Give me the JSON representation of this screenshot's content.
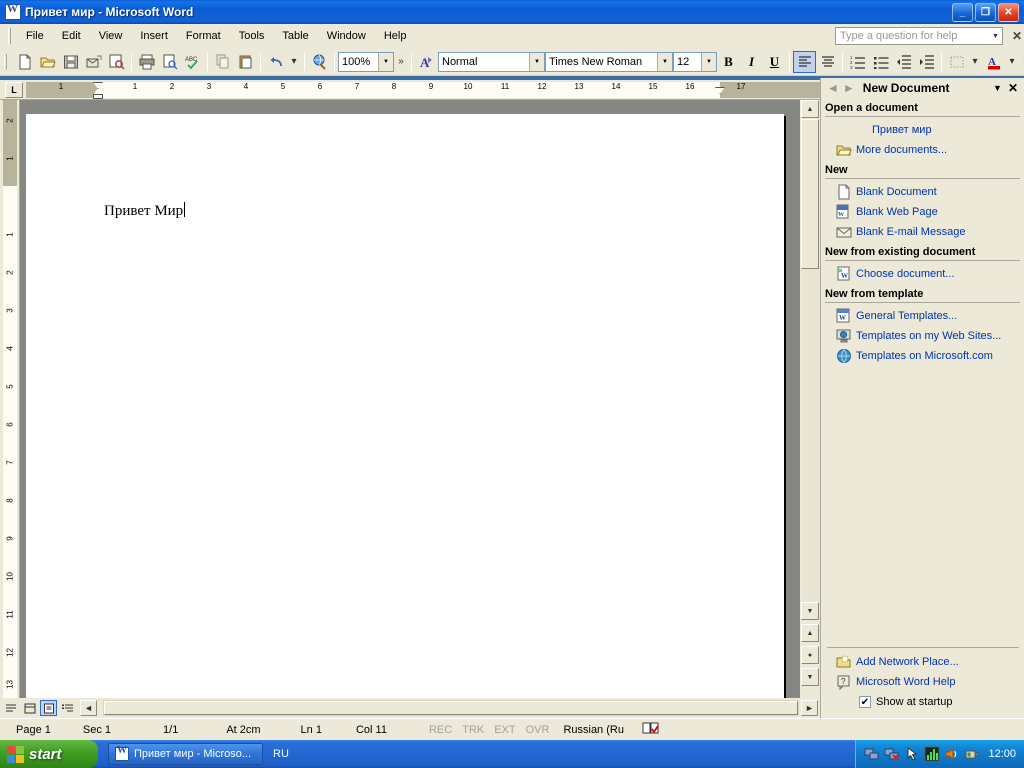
{
  "titlebar": {
    "text": "Привет мир - Microsoft Word",
    "minimize": "_",
    "restore": "❐",
    "close": "✕"
  },
  "menubar": {
    "items": [
      {
        "label": "File"
      },
      {
        "label": "Edit"
      },
      {
        "label": "View"
      },
      {
        "label": "Insert"
      },
      {
        "label": "Format"
      },
      {
        "label": "Tools"
      },
      {
        "label": "Table"
      },
      {
        "label": "Window"
      },
      {
        "label": "Help"
      }
    ],
    "help_placeholder": "Type a question for help"
  },
  "toolbar": {
    "zoom": "100%",
    "style": "Normal",
    "font": "Times New Roman",
    "size": "12",
    "bold": "B",
    "italic": "I",
    "underline": "U",
    "overflow": "»"
  },
  "ruler": {
    "tab_selector": "L",
    "h_marks": [
      "1",
      "1",
      "1",
      "2",
      "3",
      "4",
      "5",
      "6",
      "7",
      "8",
      "9",
      "10",
      "11",
      "12",
      "13",
      "14",
      "15",
      "16",
      "17"
    ],
    "v_marks": [
      "2",
      "1",
      "1",
      "2",
      "3",
      "4",
      "5",
      "6",
      "7",
      "8",
      "9",
      "10",
      "11",
      "12",
      "13"
    ]
  },
  "document": {
    "text": "Привет Мир"
  },
  "taskpane": {
    "title": "New Document",
    "back_icon": "◄",
    "forward_icon": "►",
    "dropdown_icon": "▼",
    "close_icon": "✕",
    "sections": [
      {
        "heading": "Open a document",
        "items": [
          {
            "label": "Привет мир",
            "icon": "none"
          },
          {
            "label": "More documents...",
            "icon": "folder-open-icon"
          }
        ]
      },
      {
        "heading": "New",
        "items": [
          {
            "label": "Blank Document",
            "icon": "blank-page-icon"
          },
          {
            "label": "Blank Web Page",
            "icon": "web-page-icon"
          },
          {
            "label": "Blank E-mail Message",
            "icon": "envelope-icon"
          }
        ]
      },
      {
        "heading": "New from existing document",
        "items": [
          {
            "label": "Choose document...",
            "icon": "choose-document-icon"
          }
        ]
      },
      {
        "heading": "New from template",
        "items": [
          {
            "label": "General Templates...",
            "icon": "word-template-icon"
          },
          {
            "label": "Templates on my Web Sites...",
            "icon": "web-sites-icon"
          },
          {
            "label": "Templates on Microsoft.com",
            "icon": "globe-icon"
          }
        ]
      }
    ],
    "bottom": {
      "add_network_place": "Add Network Place...",
      "word_help": "Microsoft Word Help",
      "show_at_startup": "Show at startup",
      "show_at_startup_checked": "✔"
    }
  },
  "statusbar": {
    "page": "Page  1",
    "sec": "Sec  1",
    "pages": "1/1",
    "at": "At  2cm",
    "ln": "Ln  1",
    "col": "Col  11",
    "rec": "REC",
    "trk": "TRK",
    "ext": "EXT",
    "ovr": "OVR",
    "language": "Russian (Ru"
  },
  "taskbar": {
    "start": "start",
    "task": "Привет мир - Microso...",
    "language": "RU",
    "clock": "12:00"
  },
  "colors": {
    "titlebar_blue": "#0a5ad2",
    "toolbar_bg": "#ece9d8",
    "link_blue": "#0033aa",
    "taskbar_blue": "#2a6fd8",
    "start_green": "#3f9e22"
  }
}
